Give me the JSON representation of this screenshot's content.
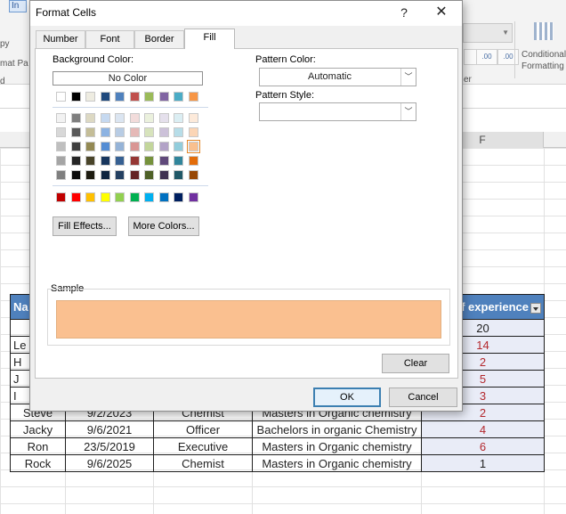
{
  "ribbon": {
    "tab_label": "In",
    "left_texts": [
      "py",
      "mat Pa",
      "d"
    ],
    "right_texts": [
      "er",
      "Conditional",
      "Formatting"
    ],
    "number_buttons": [
      ".00",
      ".00"
    ]
  },
  "sheet": {
    "column_header_F": "F",
    "headers": [
      "Na",
      "",
      "",
      "",
      "of experience"
    ],
    "rows": [
      [
        "",
        "",
        "",
        "",
        "20"
      ],
      [
        "Le",
        "",
        "",
        "",
        "14"
      ],
      [
        "H",
        "",
        "",
        "",
        "2"
      ],
      [
        "J",
        "",
        "",
        "",
        "5"
      ],
      [
        "I",
        "",
        "",
        "",
        "3"
      ],
      [
        "Steve",
        "9/2/2023",
        "Chemist",
        "Masters in Organic chemistry",
        "2"
      ],
      [
        "Jacky",
        "9/6/2021",
        "Officer",
        "Bachelors in organic Chemistry",
        "4"
      ],
      [
        "Ron",
        "23/5/2019",
        "Executive",
        "Masters in Organic chemistry",
        "6"
      ],
      [
        "Rock",
        "9/6/2025",
        "Chemist",
        "Masters in Organic chemistry",
        "1"
      ]
    ]
  },
  "dialog": {
    "title": "Format Cells",
    "help_label": "?",
    "close_label": "✕",
    "tabs": [
      {
        "label": "Number",
        "active": false
      },
      {
        "label": "Font",
        "active": false
      },
      {
        "label": "Border",
        "active": false
      },
      {
        "label": "Fill",
        "active": true
      }
    ],
    "background_color_label": "Background Color:",
    "no_color_label": "No Color",
    "theme_colors_row": [
      "#ffffff",
      "#000000",
      "#eeece1",
      "#1f497d",
      "#4f81bd",
      "#c0504d",
      "#9bbb59",
      "#8064a2",
      "#4bacc6",
      "#f79646"
    ],
    "tint_rows": [
      [
        "#f2f2f2",
        "#7f7f7f",
        "#ddd9c3",
        "#c6d9f0",
        "#dbe5f1",
        "#f2dcdb",
        "#ebf1dd",
        "#e5e0ec",
        "#dbeef3",
        "#fdeada"
      ],
      [
        "#d8d8d8",
        "#595959",
        "#c4bd97",
        "#8db3e2",
        "#b8cce4",
        "#e5b9b7",
        "#d7e3bc",
        "#ccc1d9",
        "#b7dde8",
        "#fbd5b5"
      ],
      [
        "#bfbfbf",
        "#3f3f3f",
        "#938953",
        "#548dd4",
        "#95b3d7",
        "#d99694",
        "#c3d69b",
        "#b2a2c7",
        "#92cddc",
        "#fac08f"
      ],
      [
        "#a5a5a5",
        "#262626",
        "#494429",
        "#17365d",
        "#366092",
        "#953734",
        "#76923c",
        "#5f497a",
        "#31859b",
        "#e36c09"
      ],
      [
        "#7f7f7f",
        "#0c0c0c",
        "#1d1b10",
        "#0f243e",
        "#244061",
        "#632423",
        "#4f6128",
        "#3f3151",
        "#205867",
        "#974806"
      ]
    ],
    "standard_colors": [
      "#c00000",
      "#ff0000",
      "#ffc000",
      "#ffff00",
      "#92d050",
      "#00b050",
      "#00b0f0",
      "#0070c0",
      "#002060",
      "#7030a0"
    ],
    "selected_color": "#fac08f",
    "fill_effects_label": "Fill Effects...",
    "more_colors_label": "More Colors...",
    "pattern_color_label": "Pattern Color:",
    "pattern_color_value": "Automatic",
    "pattern_style_label": "Pattern Style:",
    "pattern_style_value": "",
    "sample_label": "Sample",
    "sample_color": "#fac090",
    "clear_label": "Clear",
    "ok_label": "OK",
    "cancel_label": "Cancel"
  }
}
